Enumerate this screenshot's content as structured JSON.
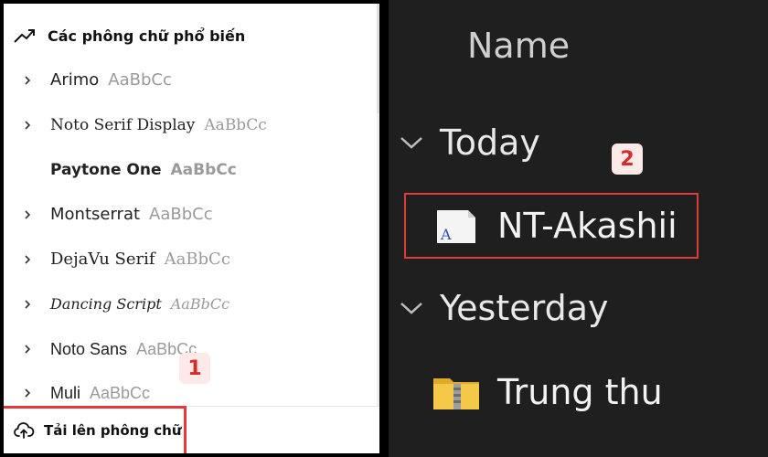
{
  "left": {
    "section_title": "Các phông chữ phổ biến",
    "sample_text": "AaBbCc",
    "fonts": [
      {
        "name": "Arimo",
        "sample": "AaBbCc"
      },
      {
        "name": "Noto Serif Display",
        "sample": "AaBbCc"
      },
      {
        "name": "Paytone One",
        "sample": "AaBbCc"
      },
      {
        "name": "Montserrat",
        "sample": "AaBbCc"
      },
      {
        "name": "DejaVu Serif",
        "sample": "AaBbCc"
      },
      {
        "name": "Dancing Script",
        "sample": "AaBbCc"
      },
      {
        "name": "Noto Sans",
        "sample": "AaBbCc"
      },
      {
        "name": "Muli",
        "sample": "AaBbCc"
      }
    ],
    "upload_label": "Tải lên phông chữ",
    "marker_1": "1"
  },
  "right": {
    "column_header": "Name",
    "groups": [
      {
        "label": "Today"
      },
      {
        "label": "Yesterday"
      }
    ],
    "files": [
      {
        "name": "NT-Akashii",
        "icon": "font-file-icon"
      },
      {
        "name": "Trung thu",
        "icon": "zip-folder-icon"
      }
    ],
    "marker_2": "2"
  },
  "colors": {
    "highlight": "#e03a3a",
    "marker_bg": "#fde9e7",
    "marker_text": "#d42b2b",
    "explorer_bg": "#1f1f1f"
  }
}
